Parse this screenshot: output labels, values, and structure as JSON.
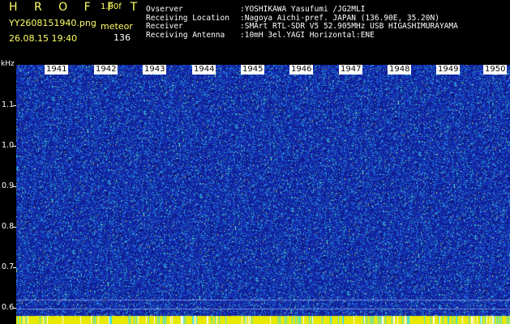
{
  "header": {
    "app_title": "H R O F F T",
    "version": "1.00f",
    "filename": "YY2608151940.png",
    "datetime": "26.08.15 19:40",
    "mode_label": "meteor",
    "count": "136"
  },
  "info": [
    {
      "label": "Ovserver",
      "value": ":YOSHIKAWA Yasufumi /JG2MLI"
    },
    {
      "label": "Receiving Location",
      "value": ":Nagoya Aichi-pref. JAPAN (136.90E, 35.20N)"
    },
    {
      "label": "Receiver",
      "value": ":SMArt RTL-SDR V5 52.905MHz USB HIGASHIMURAYAMA"
    },
    {
      "label": "Receiving Antenna",
      "value": ":10mH 3el.YAGI Horizontal:ENE"
    }
  ],
  "axis": {
    "y_unit": "kHz",
    "y_ticks": [
      "1.1",
      "1.0",
      "0.9",
      "0.8",
      "0.7",
      "0.6"
    ],
    "x_ticks": [
      "1941",
      "1942",
      "1943",
      "1944",
      "1945",
      "1946",
      "1947",
      "1948",
      "1949",
      "1950"
    ]
  },
  "colors": {
    "background": "#1430b0",
    "header_text": "#ffff66",
    "baseline": "#e8e800"
  }
}
